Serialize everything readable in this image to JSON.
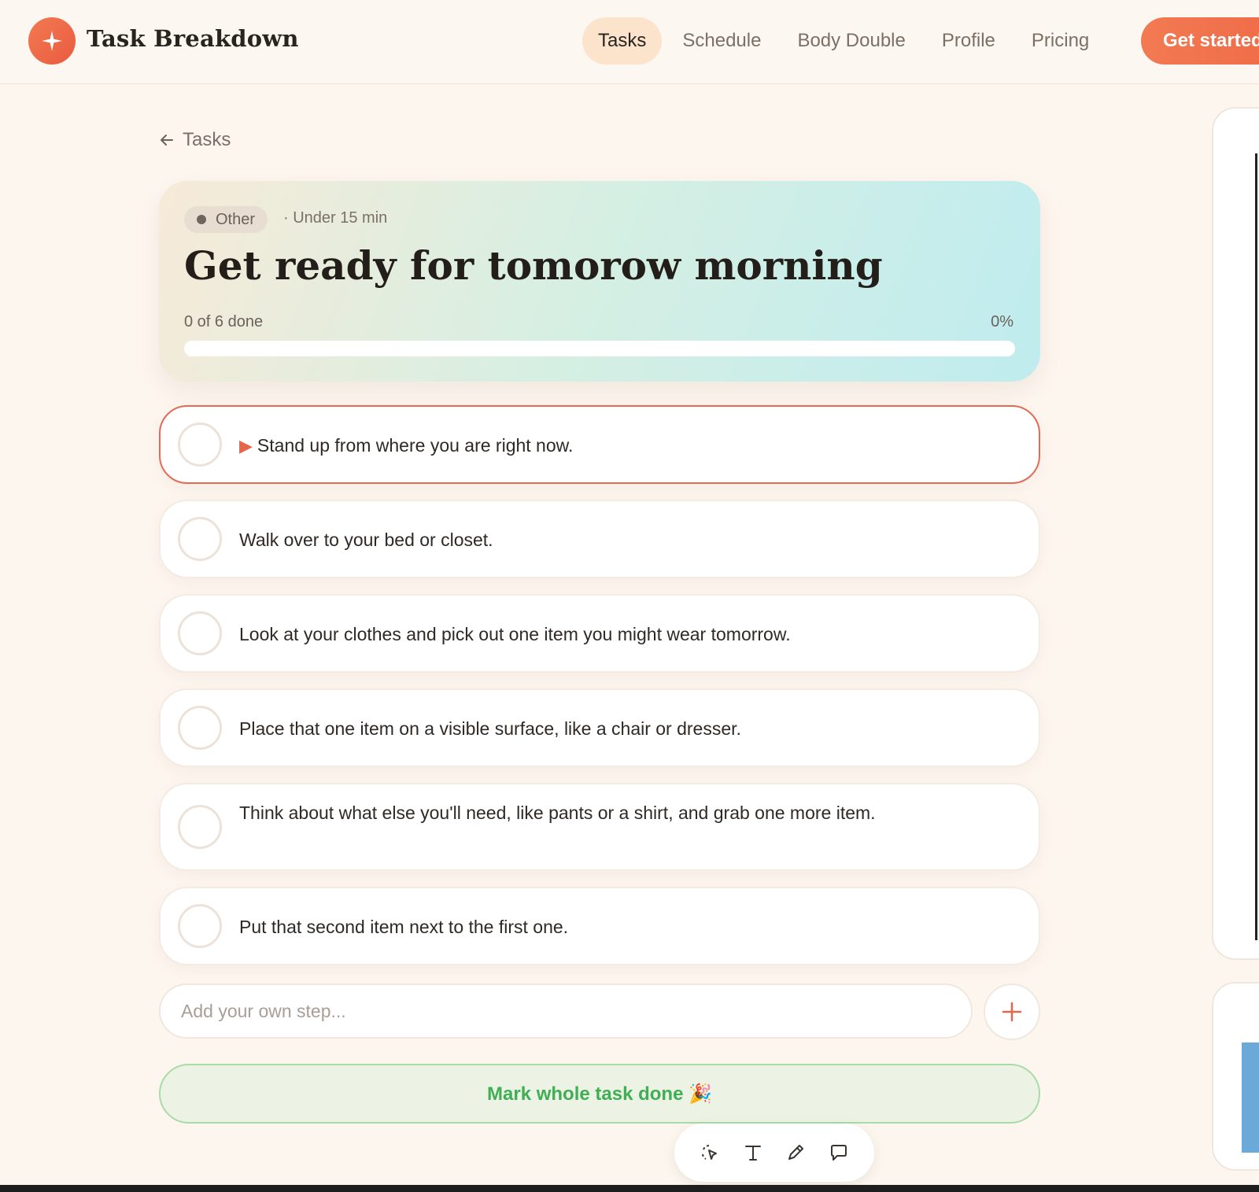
{
  "header": {
    "brand": "Task Breakdown",
    "nav": [
      {
        "label": "Tasks",
        "active": true
      },
      {
        "label": "Schedule"
      },
      {
        "label": "Body Double"
      },
      {
        "label": "Profile"
      },
      {
        "label": "Pricing"
      }
    ],
    "cta_label": "Get started"
  },
  "back_label": "Tasks",
  "task": {
    "category": "Other",
    "duration": "· Under 15 min",
    "title": "Get ready for tomorow morning",
    "progress_text": "0 of 6 done",
    "progress_percent_label": "0%",
    "progress_value": 0
  },
  "steps": [
    {
      "text": "Stand up from where you are right now.",
      "current": true,
      "done": false
    },
    {
      "text": "Walk over to your bed or closet.",
      "done": false
    },
    {
      "text": "Look at your clothes and pick out one item you might wear tomorrow.",
      "done": false
    },
    {
      "text": "Place that one item on a visible surface, like a chair or dresser.",
      "done": false
    },
    {
      "text": "Think about what else you'll need, like pants or a shirt, and grab one more item.",
      "done": false
    },
    {
      "text": "Put that second item next to the first one.",
      "done": false
    }
  ],
  "add_step": {
    "placeholder": "Add your own step..."
  },
  "mark_done_label": "Mark whole task done 🎉",
  "toolbar": {
    "tools": [
      "select-cursor-icon",
      "text-tool-icon",
      "pen-icon",
      "comment-icon"
    ]
  },
  "colors": {
    "accent": "#ef6b47",
    "success": "#3fae55",
    "background": "#fdf6ef"
  }
}
